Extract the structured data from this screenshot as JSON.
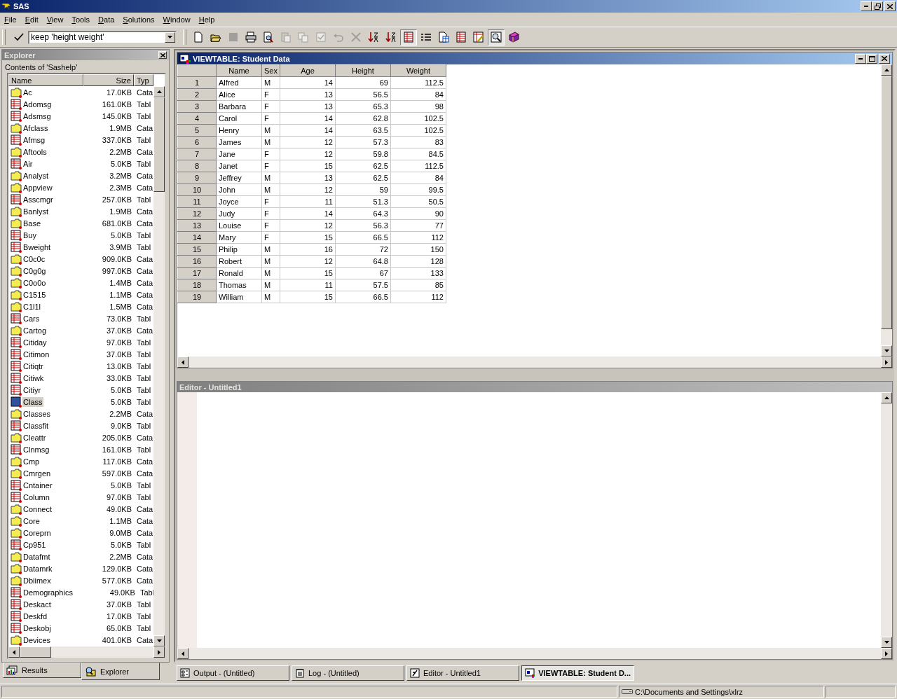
{
  "window": {
    "title": "SAS"
  },
  "menu": [
    "File",
    "Edit",
    "View",
    "Tools",
    "Data",
    "Solutions",
    "Window",
    "Help"
  ],
  "command": {
    "value": "keep 'height weight'"
  },
  "toolbar": [
    {
      "kind": "new",
      "disabled": false,
      "pressed": false
    },
    {
      "kind": "open",
      "disabled": false,
      "pressed": false
    },
    {
      "kind": "save",
      "disabled": true,
      "pressed": false
    },
    {
      "kind": "print",
      "disabled": false,
      "pressed": false
    },
    {
      "kind": "preview",
      "disabled": false,
      "pressed": false
    },
    {
      "kind": "paste",
      "disabled": true,
      "pressed": false
    },
    {
      "kind": "copy",
      "disabled": true,
      "pressed": false
    },
    {
      "kind": "check",
      "disabled": true,
      "pressed": false
    },
    {
      "kind": "undo",
      "disabled": true,
      "pressed": false
    },
    {
      "kind": "delete",
      "disabled": true,
      "pressed": false
    },
    {
      "kind": "sortasc",
      "disabled": false,
      "pressed": false
    },
    {
      "kind": "sortdesc",
      "disabled": false,
      "pressed": false
    },
    {
      "kind": "tableview",
      "disabled": false,
      "pressed": true
    },
    {
      "kind": "listview",
      "disabled": false,
      "pressed": false
    },
    {
      "kind": "newcol",
      "disabled": false,
      "pressed": false
    },
    {
      "kind": "colprops",
      "disabled": false,
      "pressed": false
    },
    {
      "kind": "edit",
      "disabled": false,
      "pressed": false
    },
    {
      "kind": "zoom",
      "disabled": false,
      "pressed": true
    },
    {
      "kind": "help",
      "disabled": false,
      "pressed": false
    }
  ],
  "explorer": {
    "title": "Explorer",
    "caption": "Contents of 'Sashelp'",
    "columns": [
      "Name",
      "Size",
      "Typ"
    ],
    "items": [
      {
        "name": "Ac",
        "size": "17.0KB",
        "type": "Cata",
        "kind": "folder",
        "selected": false
      },
      {
        "name": "Adomsg",
        "size": "161.0KB",
        "type": "Tabl",
        "kind": "table",
        "selected": false
      },
      {
        "name": "Adsmsg",
        "size": "145.0KB",
        "type": "Tabl",
        "kind": "table",
        "selected": false
      },
      {
        "name": "Afclass",
        "size": "1.9MB",
        "type": "Cata",
        "kind": "folder",
        "selected": false
      },
      {
        "name": "Afmsg",
        "size": "337.0KB",
        "type": "Tabl",
        "kind": "table",
        "selected": false
      },
      {
        "name": "Aftools",
        "size": "2.2MB",
        "type": "Cata",
        "kind": "folder",
        "selected": false
      },
      {
        "name": "Air",
        "size": "5.0KB",
        "type": "Tabl",
        "kind": "table",
        "selected": false
      },
      {
        "name": "Analyst",
        "size": "3.2MB",
        "type": "Cata",
        "kind": "folder",
        "selected": false
      },
      {
        "name": "Appview",
        "size": "2.3MB",
        "type": "Cata",
        "kind": "folder",
        "selected": false
      },
      {
        "name": "Asscmgr",
        "size": "257.0KB",
        "type": "Tabl",
        "kind": "table",
        "selected": false
      },
      {
        "name": "Banlyst",
        "size": "1.9MB",
        "type": "Cata",
        "kind": "folder",
        "selected": false
      },
      {
        "name": "Base",
        "size": "681.0KB",
        "type": "Cata",
        "kind": "folder",
        "selected": false
      },
      {
        "name": "Buy",
        "size": "5.0KB",
        "type": "Tabl",
        "kind": "table",
        "selected": false
      },
      {
        "name": "Bweight",
        "size": "3.9MB",
        "type": "Tabl",
        "kind": "table",
        "selected": false
      },
      {
        "name": "C0c0c",
        "size": "909.0KB",
        "type": "Cata",
        "kind": "folder",
        "selected": false
      },
      {
        "name": "C0g0g",
        "size": "997.0KB",
        "type": "Cata",
        "kind": "folder",
        "selected": false
      },
      {
        "name": "C0o0o",
        "size": "1.4MB",
        "type": "Cata",
        "kind": "folder",
        "selected": false
      },
      {
        "name": "C1515",
        "size": "1.1MB",
        "type": "Cata",
        "kind": "folder",
        "selected": false
      },
      {
        "name": "C1l1l",
        "size": "1.5MB",
        "type": "Cata",
        "kind": "folder",
        "selected": false
      },
      {
        "name": "Cars",
        "size": "73.0KB",
        "type": "Tabl",
        "kind": "table",
        "selected": false
      },
      {
        "name": "Cartog",
        "size": "37.0KB",
        "type": "Cata",
        "kind": "folder",
        "selected": false
      },
      {
        "name": "Citiday",
        "size": "97.0KB",
        "type": "Tabl",
        "kind": "table",
        "selected": false
      },
      {
        "name": "Citimon",
        "size": "37.0KB",
        "type": "Tabl",
        "kind": "table",
        "selected": false
      },
      {
        "name": "Citiqtr",
        "size": "13.0KB",
        "type": "Tabl",
        "kind": "table",
        "selected": false
      },
      {
        "name": "Citiwk",
        "size": "33.0KB",
        "type": "Tabl",
        "kind": "table",
        "selected": false
      },
      {
        "name": "Citiyr",
        "size": "5.0KB",
        "type": "Tabl",
        "kind": "table",
        "selected": false
      },
      {
        "name": "Class",
        "size": "5.0KB",
        "type": "Tabl",
        "kind": "table",
        "selected": true
      },
      {
        "name": "Classes",
        "size": "2.2MB",
        "type": "Cata",
        "kind": "folder",
        "selected": false
      },
      {
        "name": "Classfit",
        "size": "9.0KB",
        "type": "Tabl",
        "kind": "table",
        "selected": false
      },
      {
        "name": "Cleattr",
        "size": "205.0KB",
        "type": "Cata",
        "kind": "folder",
        "selected": false
      },
      {
        "name": "Clnmsg",
        "size": "161.0KB",
        "type": "Tabl",
        "kind": "table",
        "selected": false
      },
      {
        "name": "Cmp",
        "size": "117.0KB",
        "type": "Cata",
        "kind": "folder",
        "selected": false
      },
      {
        "name": "Cmrgen",
        "size": "597.0KB",
        "type": "Cata",
        "kind": "folder",
        "selected": false
      },
      {
        "name": "Cntainer",
        "size": "5.0KB",
        "type": "Tabl",
        "kind": "table",
        "selected": false
      },
      {
        "name": "Column",
        "size": "97.0KB",
        "type": "Tabl",
        "kind": "table",
        "selected": false
      },
      {
        "name": "Connect",
        "size": "49.0KB",
        "type": "Cata",
        "kind": "folder",
        "selected": false
      },
      {
        "name": "Core",
        "size": "1.1MB",
        "type": "Cata",
        "kind": "folder",
        "selected": false
      },
      {
        "name": "Coreprn",
        "size": "9.0MB",
        "type": "Cata",
        "kind": "folder",
        "selected": false
      },
      {
        "name": "Cp951",
        "size": "5.0KB",
        "type": "Tabl",
        "kind": "table",
        "selected": false
      },
      {
        "name": "Datafmt",
        "size": "2.2MB",
        "type": "Cata",
        "kind": "folder",
        "selected": false
      },
      {
        "name": "Datamrk",
        "size": "129.0KB",
        "type": "Cata",
        "kind": "folder",
        "selected": false
      },
      {
        "name": "Dbiimex",
        "size": "577.0KB",
        "type": "Cata",
        "kind": "folder",
        "selected": false
      },
      {
        "name": "Demographics",
        "size": "49.0KB",
        "type": "Tabl",
        "kind": "table",
        "selected": false
      },
      {
        "name": "Deskact",
        "size": "37.0KB",
        "type": "Tabl",
        "kind": "table",
        "selected": false
      },
      {
        "name": "Deskfd",
        "size": "17.0KB",
        "type": "Tabl",
        "kind": "table",
        "selected": false
      },
      {
        "name": "Deskobj",
        "size": "65.0KB",
        "type": "Tabl",
        "kind": "table",
        "selected": false
      },
      {
        "name": "Devices",
        "size": "401.0KB",
        "type": "Cata",
        "kind": "folder",
        "selected": false
      }
    ],
    "tabs": [
      {
        "label": "Results",
        "selected": false
      },
      {
        "label": "Explorer",
        "selected": true
      }
    ]
  },
  "viewtable": {
    "title": "VIEWTABLE: Student Data",
    "columns": [
      "",
      "Name",
      "Sex",
      "Age",
      "Height",
      "Weight"
    ],
    "rows": [
      [
        "1",
        "Alfred",
        "M",
        "14",
        "69",
        "112.5"
      ],
      [
        "2",
        "Alice",
        "F",
        "13",
        "56.5",
        "84"
      ],
      [
        "3",
        "Barbara",
        "F",
        "13",
        "65.3",
        "98"
      ],
      [
        "4",
        "Carol",
        "F",
        "14",
        "62.8",
        "102.5"
      ],
      [
        "5",
        "Henry",
        "M",
        "14",
        "63.5",
        "102.5"
      ],
      [
        "6",
        "James",
        "M",
        "12",
        "57.3",
        "83"
      ],
      [
        "7",
        "Jane",
        "F",
        "12",
        "59.8",
        "84.5"
      ],
      [
        "8",
        "Janet",
        "F",
        "15",
        "62.5",
        "112.5"
      ],
      [
        "9",
        "Jeffrey",
        "M",
        "13",
        "62.5",
        "84"
      ],
      [
        "10",
        "John",
        "M",
        "12",
        "59",
        "99.5"
      ],
      [
        "11",
        "Joyce",
        "F",
        "11",
        "51.3",
        "50.5"
      ],
      [
        "12",
        "Judy",
        "F",
        "14",
        "64.3",
        "90"
      ],
      [
        "13",
        "Louise",
        "F",
        "12",
        "56.3",
        "77"
      ],
      [
        "14",
        "Mary",
        "F",
        "15",
        "66.5",
        "112"
      ],
      [
        "15",
        "Philip",
        "M",
        "16",
        "72",
        "150"
      ],
      [
        "16",
        "Robert",
        "M",
        "12",
        "64.8",
        "128"
      ],
      [
        "17",
        "Ronald",
        "M",
        "15",
        "67",
        "133"
      ],
      [
        "18",
        "Thomas",
        "M",
        "11",
        "57.5",
        "85"
      ],
      [
        "19",
        "William",
        "M",
        "15",
        "66.5",
        "112"
      ]
    ]
  },
  "editor": {
    "title": "Editor - Untitled1"
  },
  "taskbar": [
    {
      "label": "Output - (Untitled)",
      "kind": "output",
      "selected": false
    },
    {
      "label": "Log - (Untitled)",
      "kind": "log",
      "selected": false
    },
    {
      "label": "Editor - Untitled1",
      "kind": "editor",
      "selected": false
    },
    {
      "label": "VIEWTABLE: Student D...",
      "kind": "viewtable",
      "selected": true
    }
  ],
  "status_bar": {
    "path": "C:\\Documents and Settings\\xlrz"
  }
}
